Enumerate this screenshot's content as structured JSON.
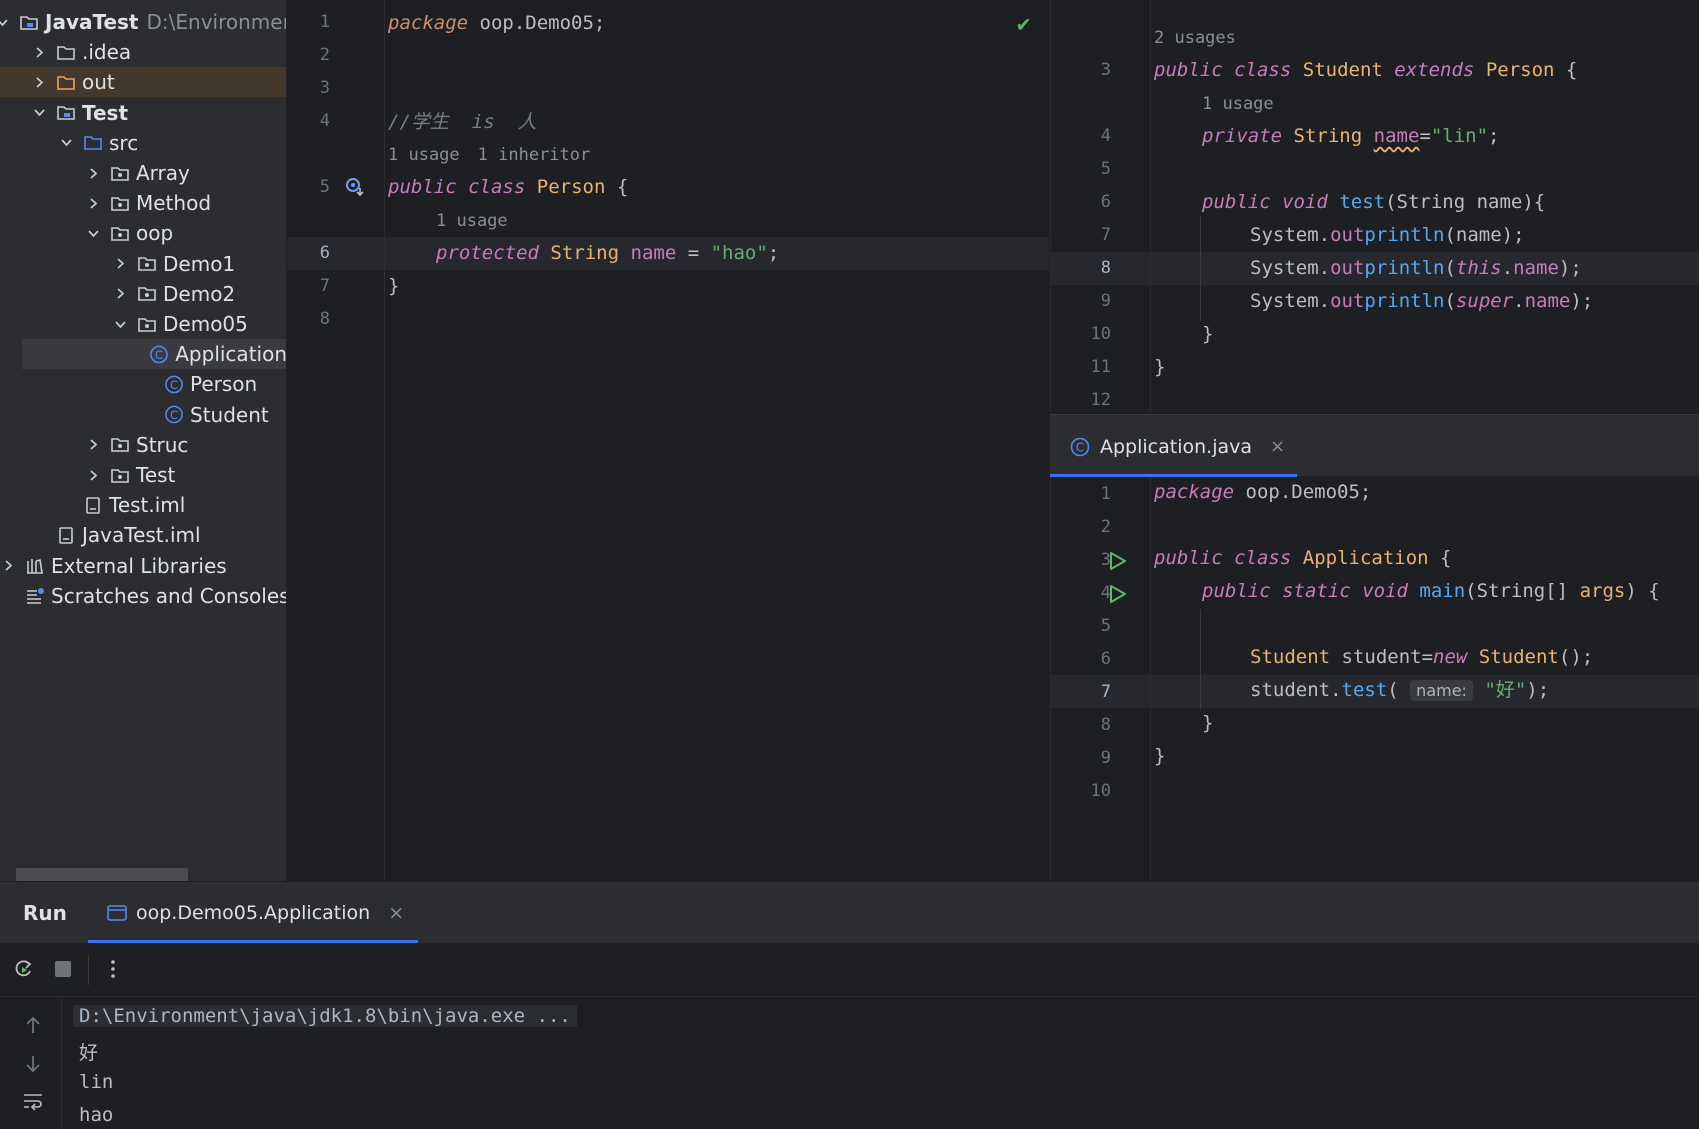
{
  "project_tree": {
    "items": [
      {
        "label": "JavaTest",
        "sub": "D:\\Environmen",
        "icon": "module-folder-icon",
        "depth": 0,
        "state": "open",
        "bold": true
      },
      {
        "label": ".idea",
        "icon": "folder-icon",
        "depth": 1,
        "state": "closed"
      },
      {
        "label": "out",
        "icon": "folder-excluded-icon",
        "depth": 1,
        "state": "closed",
        "highlight": "out"
      },
      {
        "label": "Test",
        "icon": "module-folder-icon",
        "depth": 1,
        "state": "open",
        "bold": true
      },
      {
        "label": "src",
        "icon": "source-folder-icon",
        "depth": 2,
        "state": "open"
      },
      {
        "label": "Array",
        "icon": "package-icon",
        "depth": 3,
        "state": "closed"
      },
      {
        "label": "Method",
        "icon": "package-icon",
        "depth": 3,
        "state": "closed"
      },
      {
        "label": "oop",
        "icon": "package-icon",
        "depth": 3,
        "state": "open"
      },
      {
        "label": "Demo1",
        "icon": "package-icon",
        "depth": 4,
        "state": "closed"
      },
      {
        "label": "Demo2",
        "icon": "package-icon",
        "depth": 4,
        "state": "closed"
      },
      {
        "label": "Demo05",
        "icon": "package-icon",
        "depth": 4,
        "state": "open"
      },
      {
        "label": "Application",
        "icon": "class-icon",
        "depth": 5,
        "state": "none",
        "highlight": "sel"
      },
      {
        "label": "Person",
        "icon": "class-icon",
        "depth": 5,
        "state": "none"
      },
      {
        "label": "Student",
        "icon": "class-icon",
        "depth": 5,
        "state": "none"
      },
      {
        "label": "Struc",
        "icon": "package-icon",
        "depth": 3,
        "state": "closed"
      },
      {
        "label": "Test",
        "icon": "package-icon",
        "depth": 3,
        "state": "closed"
      },
      {
        "label": "Test.iml",
        "icon": "iml-file-icon",
        "depth": 2,
        "state": "none"
      },
      {
        "label": "JavaTest.iml",
        "icon": "iml-file-icon",
        "depth": 1,
        "state": "none"
      },
      {
        "label": "External Libraries",
        "icon": "library-icon",
        "depth": 0,
        "state": "closed-small"
      },
      {
        "label": "Scratches and Consoles",
        "icon": "scratches-icon",
        "depth": 0,
        "state": "none"
      }
    ]
  },
  "person_editor": {
    "line_numbers": [
      "1",
      "2",
      "3",
      "4",
      "5",
      "6",
      "7",
      "8"
    ],
    "current_line": "6",
    "check_icon": "inspection-ok-icon",
    "code": {
      "l1_kw": "package",
      "l1_rest": " oop.Demo05;",
      "l4_comment": "//学生  is  人",
      "hint_usage": "1 usage",
      "hint_inheritor": "1 inheritor",
      "l5_kw1": "public",
      "l5_kw2": "class",
      "l5_name": "Person",
      "l5_rest": " {",
      "hint_field": "1 usage",
      "l6_kw": "protected",
      "l6_type": "String",
      "l6_field": "name",
      "l6_eq": " = ",
      "l6_str": "\"hao\"",
      "l6_end": ";",
      "l7": "}"
    }
  },
  "student_editor": {
    "line_numbers": [
      "3",
      "4",
      "5",
      "6",
      "7",
      "8",
      "9",
      "10",
      "11",
      "12"
    ],
    "current_line": "8",
    "code": {
      "hint_class": "2 usages",
      "l3_kw1": "public",
      "l3_kw2": "class",
      "l3_name": "Student",
      "l3_kw3": "extends",
      "l3_super": "Person",
      "l3_end": " {",
      "hint_field": "1 usage",
      "l4_kw": "private",
      "l4_type": "String",
      "l4_field": "name",
      "l4_eq": "=",
      "l4_str": "\"lin\"",
      "l4_end": ";",
      "l6_kw1": "public",
      "l6_kw2": "void",
      "l6_fn": "test",
      "l6_rest": "(String name){",
      "sys": "System.",
      "out": "out",
      ".": ".",
      "println": "println",
      "l7_arg": "(name);",
      "l8_open": "(",
      "l8_this": "this",
      "l8_dot": ".",
      "l8_name": "name",
      "l8_close": ");",
      "l9_super": "super",
      "l10": "}",
      "l11": "}"
    }
  },
  "app_tab": {
    "label": "Application.java",
    "icon": "class-icon",
    "close": "×"
  },
  "app_editor": {
    "line_numbers": [
      "1",
      "2",
      "3",
      "4",
      "5",
      "6",
      "7",
      "8",
      "9",
      "10"
    ],
    "current_line": "7",
    "run_icon": "run-gutter-icon",
    "code": {
      "l1_kw": "package",
      "l1_rest": " oop.Demo05;",
      "l3_kw1": "public",
      "l3_kw2": "class",
      "l3_name": "Application",
      "l3_end": " {",
      "l4_kw1": "public",
      "l4_kw2": "static",
      "l4_kw3": "void",
      "l4_fn": "main",
      "l4_open": "(String[] ",
      "l4_args": "args",
      "l4_end": ") {",
      "l6_type": "Student",
      "l6_var": " student=",
      "l6_new": "new",
      "l6_ctor": " Student",
      "l6_end": "();",
      "l7_obj": "student.",
      "l7_fn": "test",
      "l7_open": "( ",
      "l7_hint": "name:",
      "l7_str": "\"好\"",
      "l7_end": ");",
      "l8": "}",
      "l9": "}"
    }
  },
  "run_panel": {
    "title": "Run",
    "tab_label": "oop.Demo05.Application",
    "tab_icon": "console-icon",
    "tab_close": "×",
    "toolbar": [
      "rerun-icon",
      "stop-icon",
      "more-icon"
    ],
    "console_lines": [
      "D:\\Environment\\java\\jdk1.8\\bin\\java.exe ...",
      "好",
      "lin",
      "hao"
    ],
    "gutter_icons": [
      "scroll-up-icon",
      "scroll-down-icon",
      "soft-wrap-icon"
    ]
  },
  "colors": {
    "accent": "#3574f0",
    "keyword": "#cf8e6d",
    "field": "#c77dbb",
    "string": "#6aab73",
    "function": "#56a8f5",
    "type": "#e8b46f"
  }
}
